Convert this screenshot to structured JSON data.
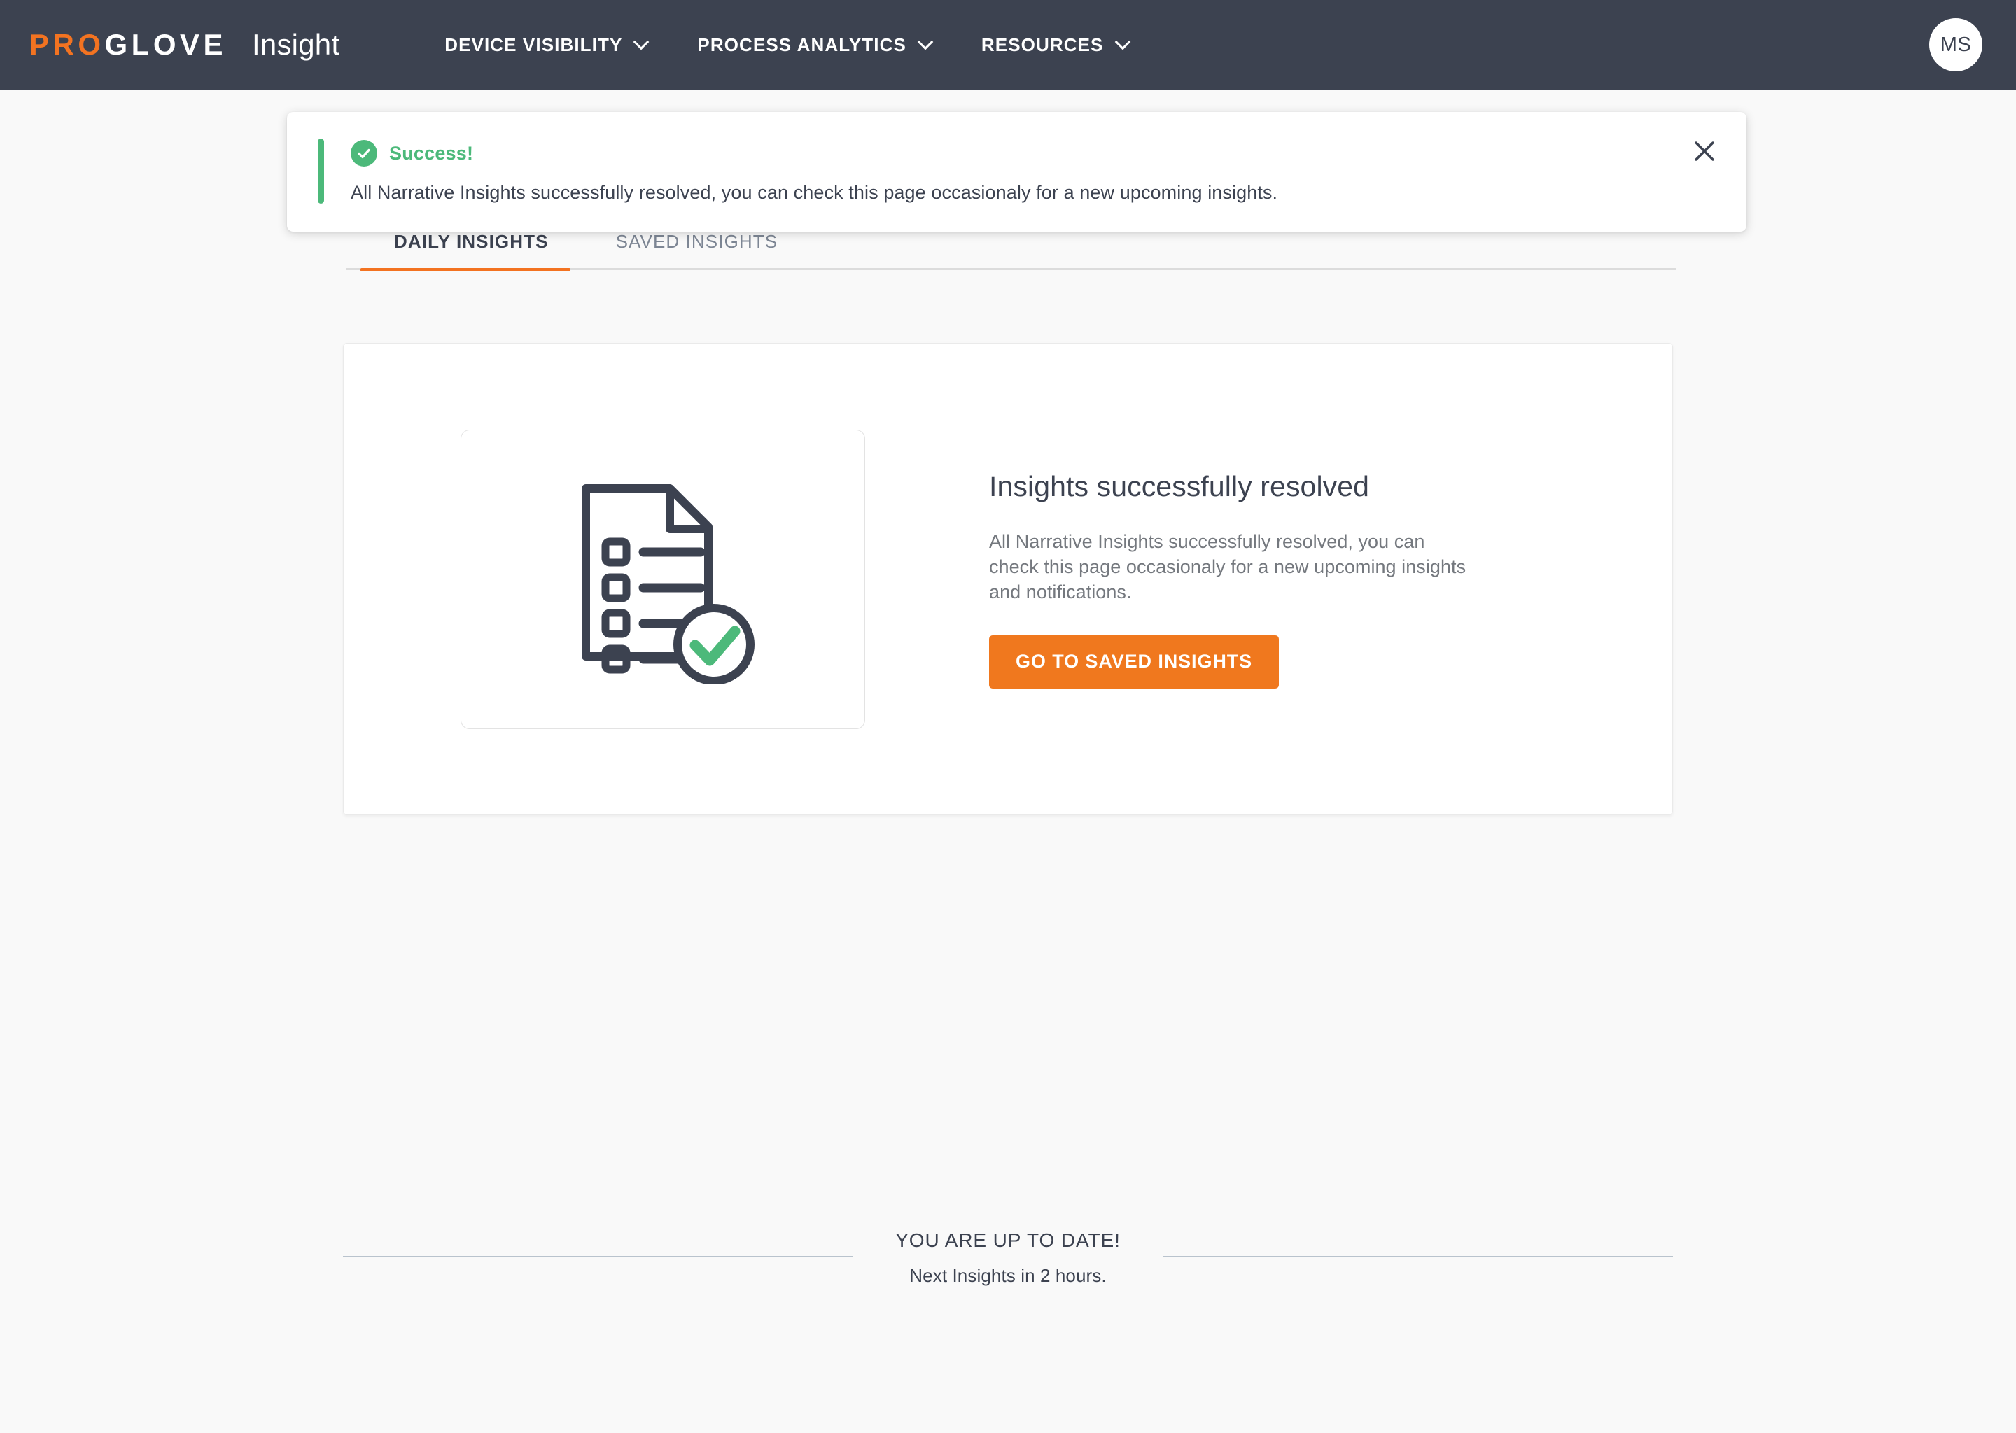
{
  "header": {
    "logo_pro": "PRO",
    "logo_glove": "GLOVE",
    "product": "Insight",
    "nav": [
      {
        "label": "DEVICE VISIBILITY",
        "icon": "chevron-down-icon"
      },
      {
        "label": "PROCESS ANALYTICS",
        "icon": "chevron-down-icon"
      },
      {
        "label": "RESOURCES",
        "icon": "chevron-down-icon"
      }
    ],
    "avatar_initials": "MS",
    "bg_color": "#3c4250",
    "accent_color": "#f37321"
  },
  "toast": {
    "title": "Success!",
    "message": "All Narrative Insights successfully resolved, you can check this page occasionaly for a new upcoming insights.",
    "accent_color": "#4cb97a",
    "close_icon": "close-icon",
    "status_icon": "check-circle-icon"
  },
  "tabs": [
    {
      "label": "DAILY INSIGHTS",
      "active": true
    },
    {
      "label": "SAVED INSIGHTS",
      "active": false
    }
  ],
  "card": {
    "illustration_icon": "document-checklist-success-icon",
    "title": "Insights successfully resolved",
    "description": "All Narrative Insights successfully resolved, you can check this page occasionaly for a new upcoming insights and notifications.",
    "cta_label": "GO TO SAVED INSIGHTS",
    "cta_color": "#f0781e"
  },
  "footer": {
    "title": "YOU ARE UP TO DATE!",
    "subtitle": "Next Insights in 2 hours."
  }
}
